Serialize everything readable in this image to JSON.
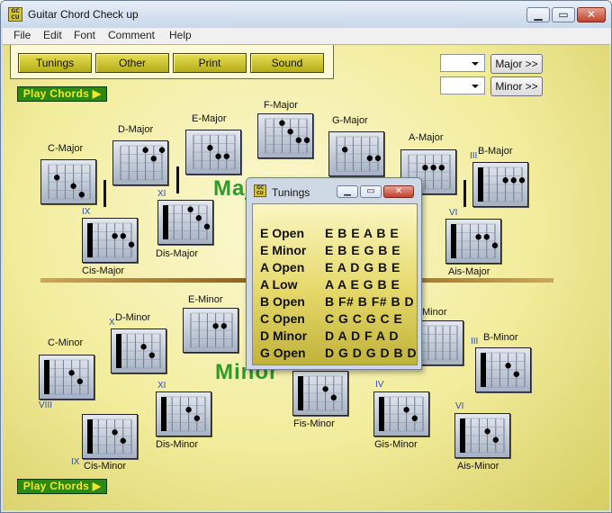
{
  "window": {
    "title": "Guitar Chord Check up",
    "icon_text": "GC CU"
  },
  "menu": [
    "File",
    "Edit",
    "Font",
    "Comment",
    "Help"
  ],
  "toolbar": [
    "Tunings",
    "Other",
    "Print",
    "Sound"
  ],
  "play_button_top": "Play Chords ▶",
  "play_button_bottom": "Play Chords ▶",
  "scale_buttons": {
    "major": "Major >>",
    "minor": "Minor >>"
  },
  "section_labels": {
    "major": "Major",
    "minor": "Minor"
  },
  "major_chords": [
    {
      "name": "C-Major",
      "dots": [
        [
          1,
          1
        ],
        [
          3,
          2
        ],
        [
          4,
          3
        ]
      ],
      "barre": false
    },
    {
      "name": "D-Major",
      "dots": [
        [
          3,
          0
        ],
        [
          4,
          1
        ],
        [
          5,
          0
        ]
      ],
      "barre": false
    },
    {
      "name": "E-Major",
      "dots": [
        [
          2,
          1
        ],
        [
          3,
          2
        ],
        [
          4,
          2
        ]
      ],
      "barre": false
    },
    {
      "name": "F-Major",
      "dots": [
        [
          2,
          0
        ],
        [
          3,
          1
        ],
        [
          4,
          2
        ],
        [
          5,
          2
        ]
      ],
      "barre": false
    },
    {
      "name": "G-Major",
      "dots": [
        [
          1,
          1
        ],
        [
          4,
          2
        ],
        [
          5,
          2
        ]
      ],
      "barre": false
    },
    {
      "name": "A-Major",
      "dots": [
        [
          2,
          1
        ],
        [
          3,
          1
        ],
        [
          4,
          1
        ]
      ],
      "barre": false
    },
    {
      "name": "B-Major",
      "dots": [
        [
          3,
          1
        ],
        [
          4,
          1
        ],
        [
          5,
          1
        ]
      ],
      "barre": true
    },
    {
      "name": "Cis-Major",
      "dots": [
        [
          3,
          1
        ],
        [
          4,
          1
        ],
        [
          5,
          2
        ]
      ],
      "barre": true,
      "roman": "IX"
    },
    {
      "name": "Dis-Major",
      "dots": [
        [
          3,
          0
        ],
        [
          4,
          1
        ],
        [
          5,
          2
        ]
      ],
      "barre": true,
      "roman": "XI"
    },
    {
      "name": "Ais-Major",
      "dots": [
        [
          3,
          1
        ],
        [
          4,
          1
        ],
        [
          5,
          2
        ]
      ],
      "barre": true,
      "roman": "VI"
    }
  ],
  "minor_chords": [
    {
      "name": "C-Minor",
      "dots": [
        [
          3,
          1
        ],
        [
          4,
          2
        ]
      ],
      "barre": true,
      "roman": "VIII"
    },
    {
      "name": "D-Minor",
      "dots": [
        [
          3,
          1
        ],
        [
          4,
          2
        ]
      ],
      "barre": true,
      "roman": "X"
    },
    {
      "name": "E-Minor",
      "dots": [
        [
          3,
          1
        ],
        [
          4,
          1
        ]
      ],
      "barre": false
    },
    {
      "name": "Cis-Minor",
      "dots": [
        [
          3,
          1
        ],
        [
          4,
          2
        ]
      ],
      "barre": true,
      "roman": "IX"
    },
    {
      "name": "Dis-Minor",
      "dots": [
        [
          3,
          1
        ],
        [
          4,
          2
        ]
      ],
      "barre": true,
      "roman": "XI"
    },
    {
      "name": "Fis-Minor",
      "dots": [
        [
          3,
          1
        ],
        [
          4,
          2
        ]
      ],
      "barre": true
    },
    {
      "name": "Gis-Minor",
      "dots": [
        [
          3,
          1
        ],
        [
          4,
          2
        ]
      ],
      "barre": true,
      "roman": "IV"
    },
    {
      "name": "Ais-Minor",
      "dots": [
        [
          3,
          1
        ],
        [
          4,
          2
        ]
      ],
      "barre": true,
      "roman": "VI"
    },
    {
      "name": "B-Minor",
      "dots": [
        [
          3,
          1
        ],
        [
          4,
          2
        ]
      ],
      "barre": true,
      "roman": "III"
    },
    {
      "name": "Minor",
      "dots": [],
      "barre": false
    }
  ],
  "b_major_roman": "III",
  "tunings_dialog": {
    "title": "Tunings",
    "rows": [
      {
        "name": "E Open",
        "notes": "E B E A B E"
      },
      {
        "name": "E Minor",
        "notes": "E B E G B E"
      },
      {
        "name": "A Open",
        "notes": "E A D G B E"
      },
      {
        "name": "A Low",
        "notes": "A A E G B E"
      },
      {
        "name": "B Open",
        "notes": "B F# B F# B D"
      },
      {
        "name": "C Open",
        "notes": "C G C G C E"
      },
      {
        "name": "D Minor",
        "notes": "D A D F A D"
      },
      {
        "name": "G Open",
        "notes": "D G D G D B D"
      }
    ]
  }
}
